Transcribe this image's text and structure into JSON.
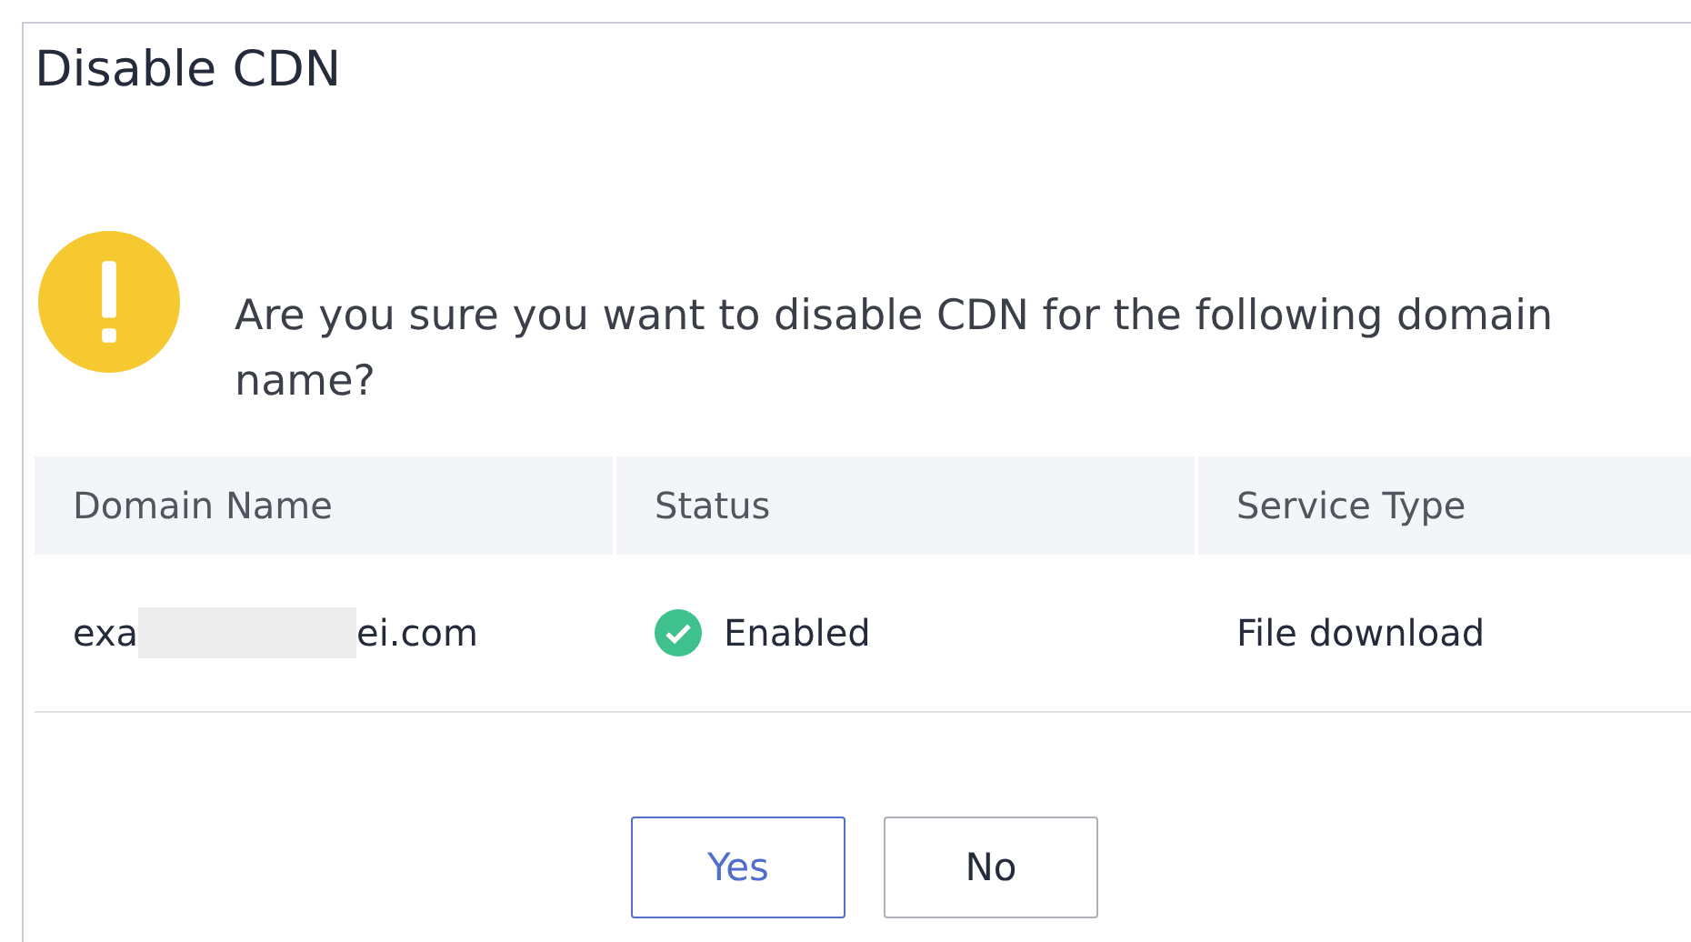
{
  "dialog": {
    "title": "Disable CDN",
    "message": "Are you sure you want to disable CDN for the following domain name?"
  },
  "table": {
    "columns": [
      "Domain Name",
      "Status",
      "Service Type"
    ],
    "rows": [
      {
        "domain_start": "exa",
        "domain_end": "ei.com",
        "status": "Enabled",
        "enabled": true,
        "service_type": "File download"
      }
    ]
  },
  "buttons": [
    {
      "label": "Yes",
      "selected": true
    },
    {
      "label": "No",
      "selected": false
    }
  ]
}
